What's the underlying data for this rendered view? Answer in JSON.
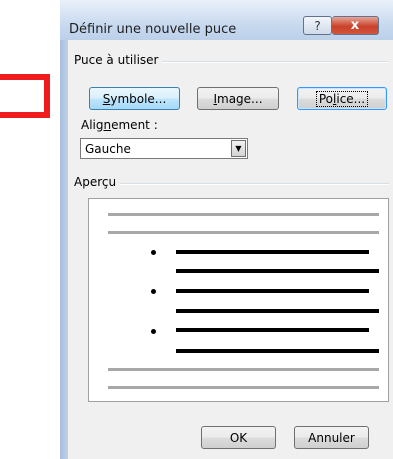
{
  "dialog": {
    "title": "Définir une nouvelle puce",
    "help_glyph": "?",
    "close_glyph": "x"
  },
  "bullet_group": {
    "label": "Puce à utiliser",
    "symbol_button": {
      "pre": "",
      "accel": "S",
      "post": "ymbole..."
    },
    "image_button": {
      "pre": "",
      "accel": "I",
      "post": "mage..."
    },
    "font_button": {
      "pre": "Po",
      "accel": "l",
      "post": "ice..."
    }
  },
  "alignment": {
    "label_pre": "Alig",
    "label_accel": "n",
    "label_post": "ement :",
    "value": "Gauche"
  },
  "preview": {
    "label": "Aperçu",
    "bullet_count": 3
  },
  "buttons": {
    "ok": "OK",
    "cancel": "Annuler"
  },
  "colors": {
    "annotation": "#ee1c1c",
    "close_button": "#c9422b"
  }
}
